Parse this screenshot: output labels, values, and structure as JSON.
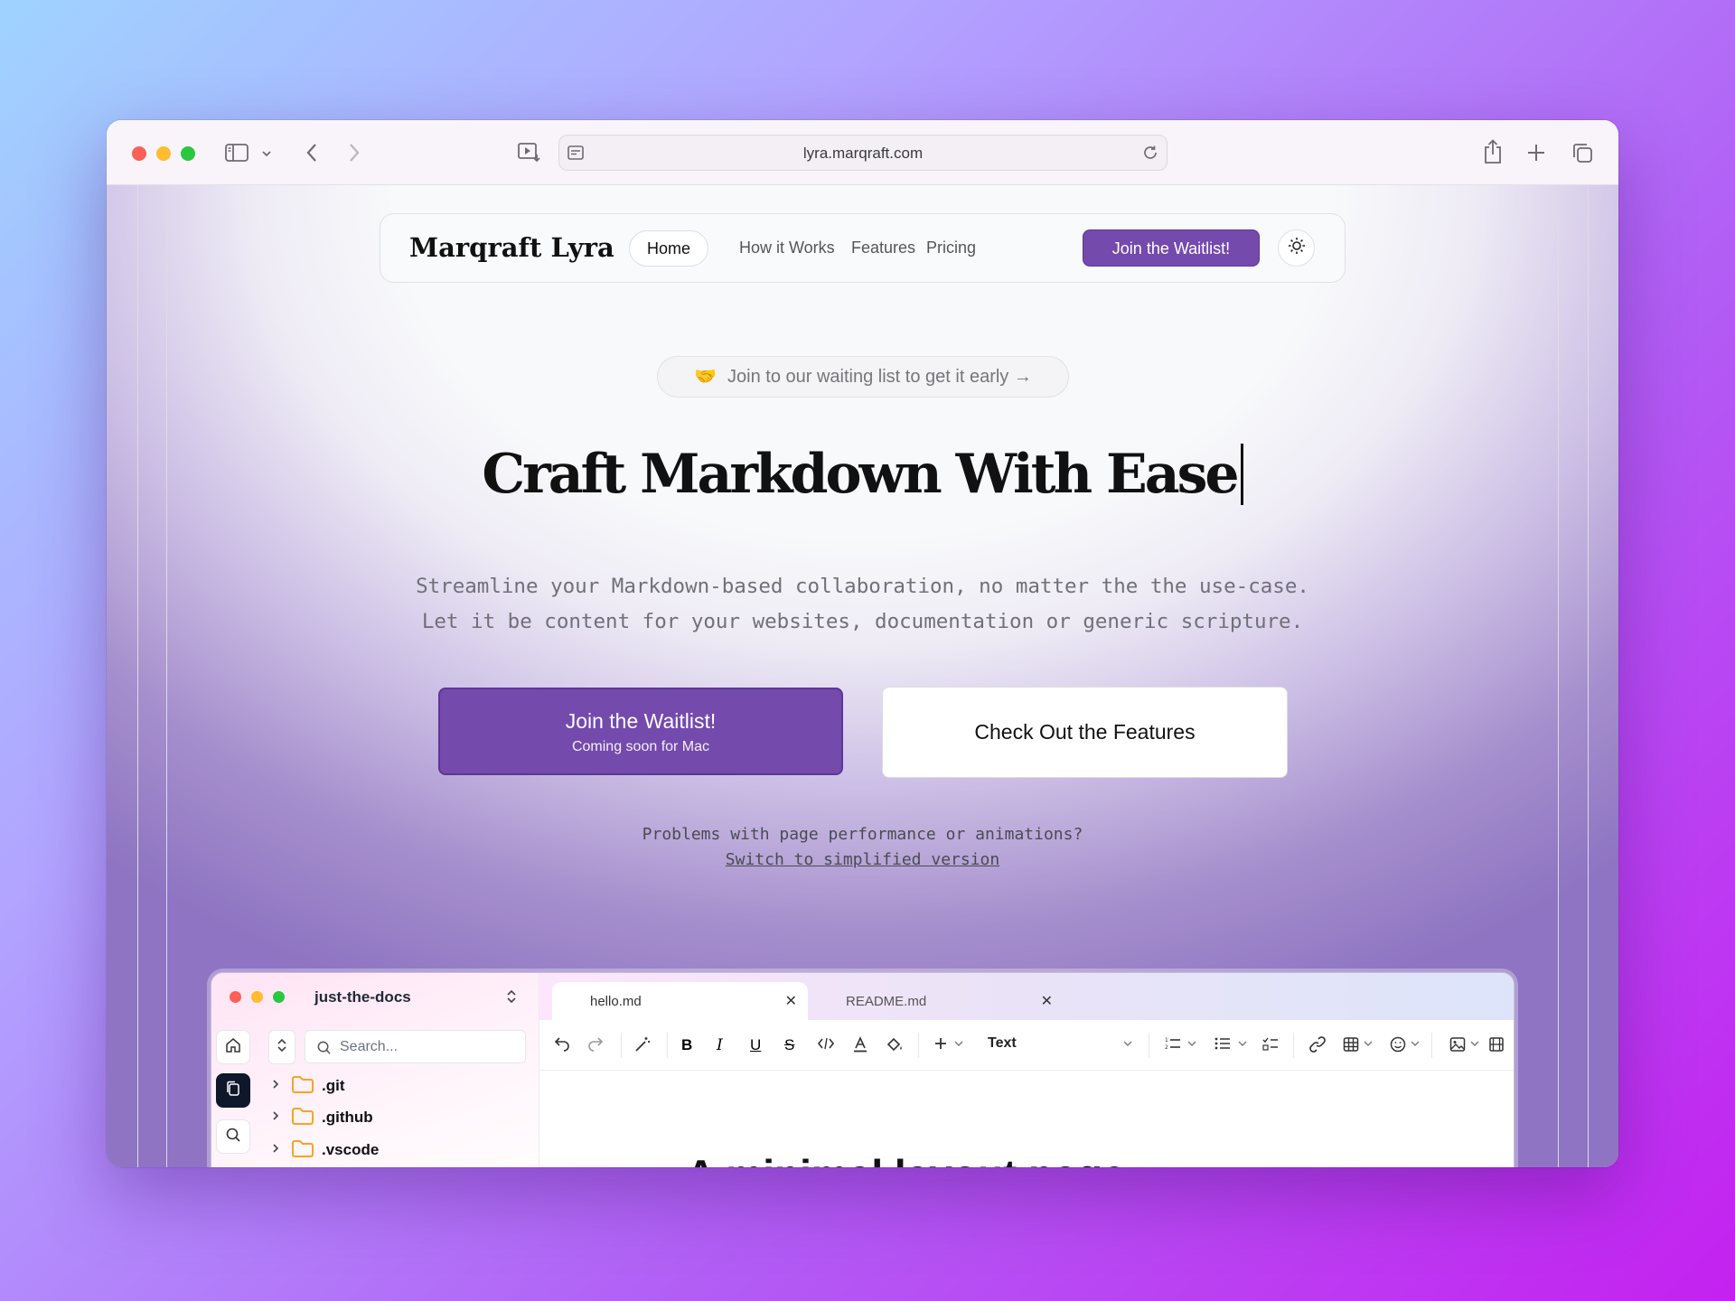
{
  "browser": {
    "url": "lyra.marqraft.com",
    "icons": [
      "sidebar-toggle-icon",
      "chevron-down-icon",
      "back-arrow-icon",
      "forward-arrow-icon",
      "picture-in-picture-icon",
      "page-settings-icon",
      "reload-icon",
      "share-icon",
      "new-tab-plus-icon",
      "tab-overview-icon"
    ]
  },
  "nav": {
    "brand": "Marqraft Lyra",
    "links": [
      "Home",
      "How it Works",
      "Features",
      "Pricing"
    ],
    "cta": "Join the Waitlist!",
    "theme_icon": "sun-icon"
  },
  "hero": {
    "pill_emoji": "🤝",
    "pill_text": "Join to our waiting list to get it early →",
    "headline": "Craft Markdown With Ease",
    "subline_1": "Streamline your Markdown-based collaboration, no matter the the use-case.",
    "subline_2": "Let it be content for your websites, documentation or generic scripture.",
    "primary_button_label": "Join the Waitlist!",
    "primary_button_sublabel": "Coming soon for Mac",
    "secondary_button_label": "Check Out the Features",
    "perf_question": "Problems with page performance or animations?",
    "perf_link": "Switch to simplified version"
  },
  "app_preview": {
    "project_name": "just-the-docs",
    "search_placeholder": "Search...",
    "tree": [
      ".git",
      ".github",
      ".vscode"
    ],
    "tabs": [
      "hello.md",
      "README.md"
    ],
    "block_type": "Text",
    "doc_heading": "A minimal layout page"
  },
  "colors": {
    "accent": "#744aad",
    "accent_border": "#5c3794",
    "folder": "#f5a524"
  }
}
